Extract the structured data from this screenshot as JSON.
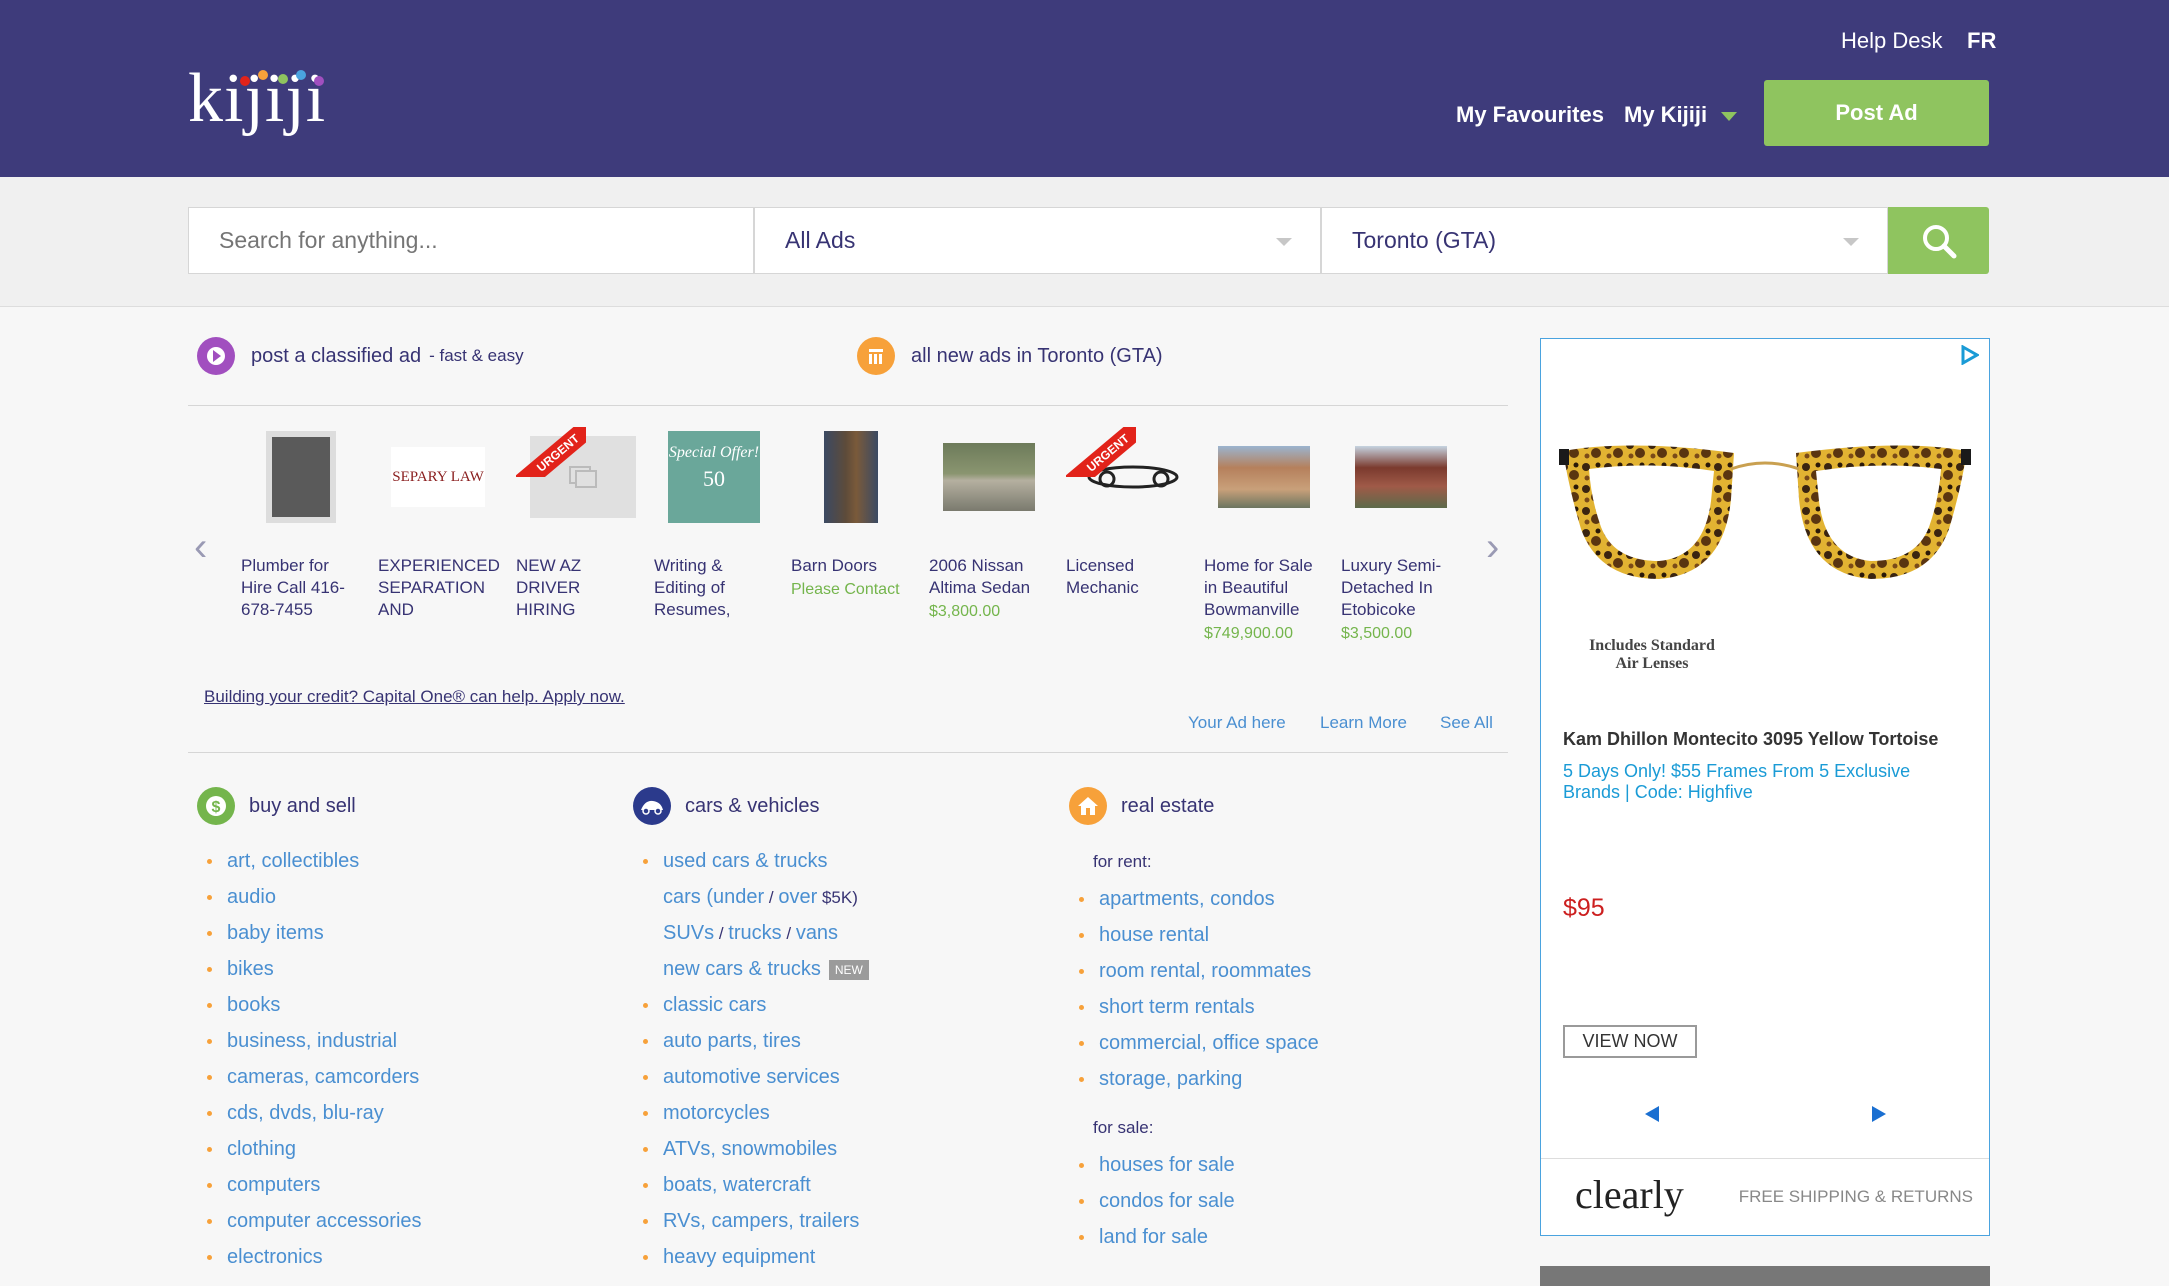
{
  "header": {
    "logo": "kijiji",
    "help_desk": "Help Desk",
    "lang": "FR",
    "favourites": "My Favourites",
    "my_kijiji": "My Kijiji",
    "post_ad": "Post Ad"
  },
  "search": {
    "placeholder": "Search for anything...",
    "category": "All Ads",
    "location": "Toronto (GTA)"
  },
  "promos": {
    "post_main": "post a classified ad",
    "post_sub": "- fast & easy",
    "new_ads": "all new ads in Toronto (GTA)"
  },
  "gallery": [
    {
      "title": "Plumber for Hire Call 416-678-7455",
      "price": "",
      "urgent": false
    },
    {
      "title": "EXPERIENCED SEPARATION AND",
      "price": "",
      "urgent": false
    },
    {
      "title": "NEW AZ DRIVER HIRING",
      "price": "",
      "urgent": true
    },
    {
      "title": "Writing & Editing of Resumes,",
      "price": "",
      "urgent": false
    },
    {
      "title": "Barn Doors",
      "price": "Please Contact",
      "urgent": false
    },
    {
      "title": "2006 Nissan Altima Sedan",
      "price": "$3,800.00",
      "urgent": false
    },
    {
      "title": "Licensed Mechanic",
      "price": "",
      "urgent": true
    },
    {
      "title": "Home for Sale in Beautiful Bowmanville",
      "price": "$749,900.00",
      "urgent": false
    },
    {
      "title": "Luxury Semi-Detached In Etobicoke",
      "price": "$3,500.00",
      "urgent": false
    }
  ],
  "gallery_thumb_text": {
    "law": "SEPARY LAW",
    "special": "Special Offer!",
    "fifty": "50",
    "urgent": "URGENT"
  },
  "sponsor": "Building your credit? Capital One® can help. Apply now.",
  "gallery_links": {
    "your_ad": "Your Ad here",
    "learn_more": "Learn More",
    "see_all": "See All"
  },
  "buy_sell": {
    "title": "buy and sell",
    "items": [
      "art, collectibles",
      "audio",
      "baby items",
      "bikes",
      "books",
      "business, industrial",
      "cameras, camcorders",
      "cds, dvds, blu-ray",
      "clothing",
      "computers",
      "computer accessories",
      "electronics"
    ]
  },
  "cars": {
    "title": "cars & vehicles",
    "used": "used cars & trucks",
    "cars_word": "cars (",
    "under": "under",
    "slash": " / ",
    "over": "over",
    "price_suffix": " $5K)",
    "suvs": "SUVs",
    "trucks": "trucks",
    "vans": "vans",
    "new_cars": "new cars & trucks",
    "new_tag": "NEW",
    "items": [
      "classic cars",
      "auto parts, tires",
      "automotive services",
      "motorcycles",
      "ATVs, snowmobiles",
      "boats, watercraft",
      "RVs, campers, trailers",
      "heavy equipment"
    ]
  },
  "real_estate": {
    "title": "real estate",
    "for_rent": "for rent:",
    "rent_items": [
      "apartments, condos",
      "house rental",
      "room rental, roommates",
      "short term rentals",
      "commercial, office space",
      "storage, parking"
    ],
    "for_sale": "for sale:",
    "sale_items": [
      "houses for sale",
      "condos for sale",
      "land for sale"
    ]
  },
  "ad": {
    "lens": "Includes Standard Air Lenses",
    "title": "Kam Dhillon Montecito 3095 Yellow Tortoise",
    "desc": "5 Days Only! $55 Frames From 5 Exclusive Brands | Code: Highfive",
    "price": "$95",
    "button": "VIEW NOW",
    "brand": "clearly",
    "shipping": "FREE SHIPPING & RETURNS"
  }
}
